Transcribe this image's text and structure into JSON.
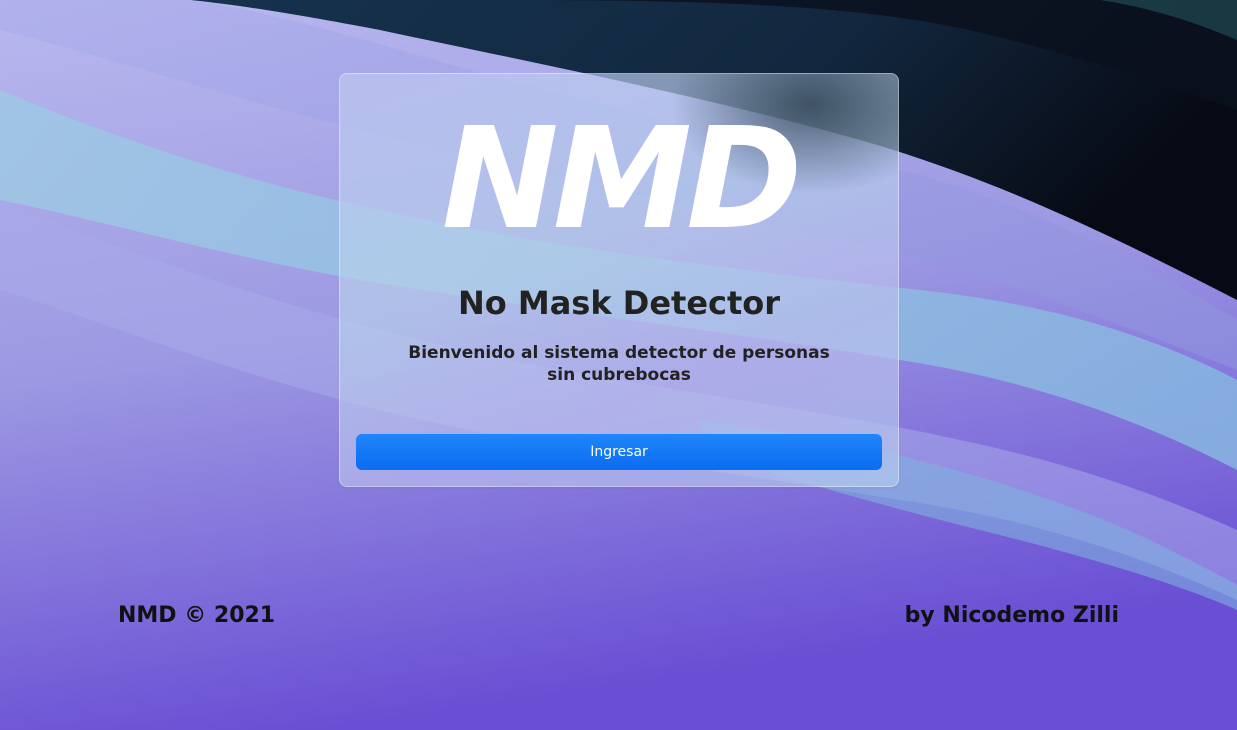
{
  "logo": {
    "text": "NMD"
  },
  "title": "No Mask Detector",
  "subtitle": "Bienvenido al sistema detector de personas sin cubrebocas",
  "button": {
    "label": "Ingresar",
    "color": "#0a6cf0"
  },
  "footer": {
    "left": "NMD © 2021",
    "right": "by Nicodemo Zilli"
  },
  "colors": {
    "accent": "#0a6cf0",
    "wallpaper_purple": "#6a4fd4",
    "wallpaper_lavender": "#a9a8e8",
    "wallpaper_teal": "#8fc2e0",
    "wallpaper_dark": "#0e1a2a"
  }
}
